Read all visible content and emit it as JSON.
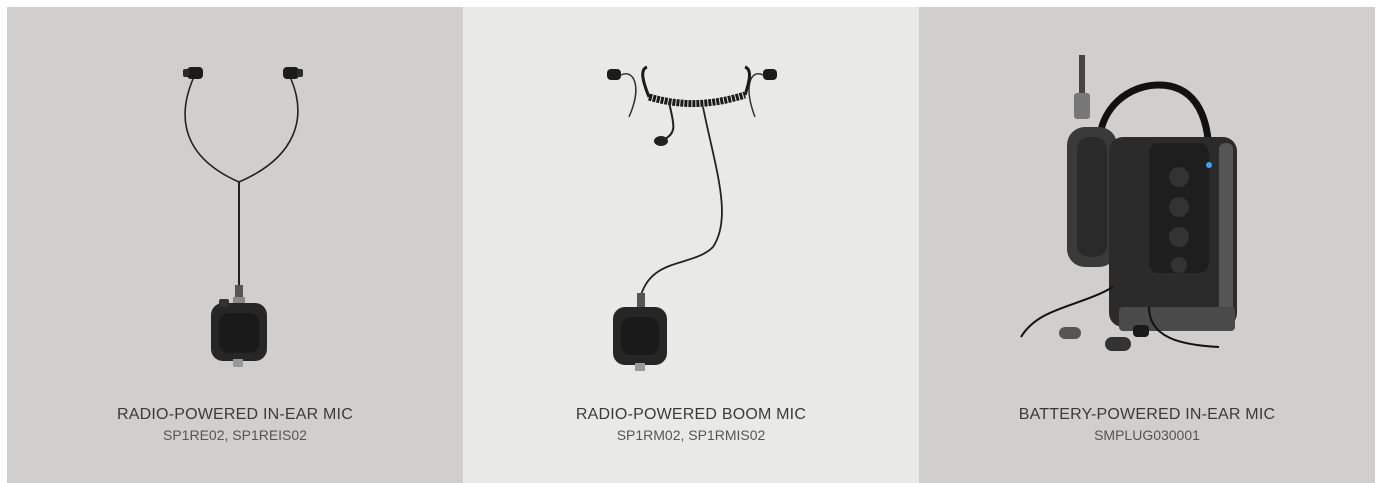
{
  "products": [
    {
      "title": "RADIO-POWERED IN-EAR MIC",
      "sku": "SP1RE02, SP1REIS02"
    },
    {
      "title": "RADIO-POWERED BOOM MIC",
      "sku": "SP1RM02, SP1RMIS02"
    },
    {
      "title": "BATTERY-POWERED IN-EAR MIC",
      "sku": "SMPLUG030001"
    }
  ],
  "colors": {
    "panel_gray": "#d0cfcd",
    "panel_light": "#e9eae8",
    "text_dark": "#3a3a3a"
  }
}
